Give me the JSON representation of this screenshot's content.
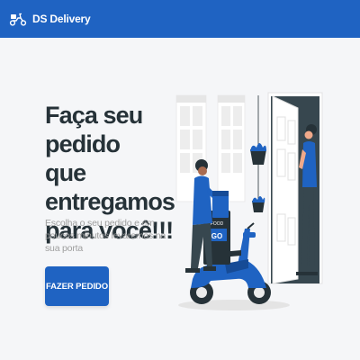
{
  "navbar": {
    "brand": "DS Delivery",
    "logo_icon": "scooter-icon"
  },
  "hero": {
    "title": "Faça seu pedido\nque entregamos\npara você!!!",
    "subtitle": "Escolha o seu pedido e em poucos minutos levaremos na sua porta",
    "cta_label": "FAZER PEDIDO"
  },
  "illustration": {
    "bag_text_top": "FOOD",
    "bag_text_bottom": "GO"
  },
  "colors": {
    "primary": "#1f63c2",
    "title": "#263238",
    "subtitle": "#9e9e9e",
    "background": "#f5f6f8"
  }
}
